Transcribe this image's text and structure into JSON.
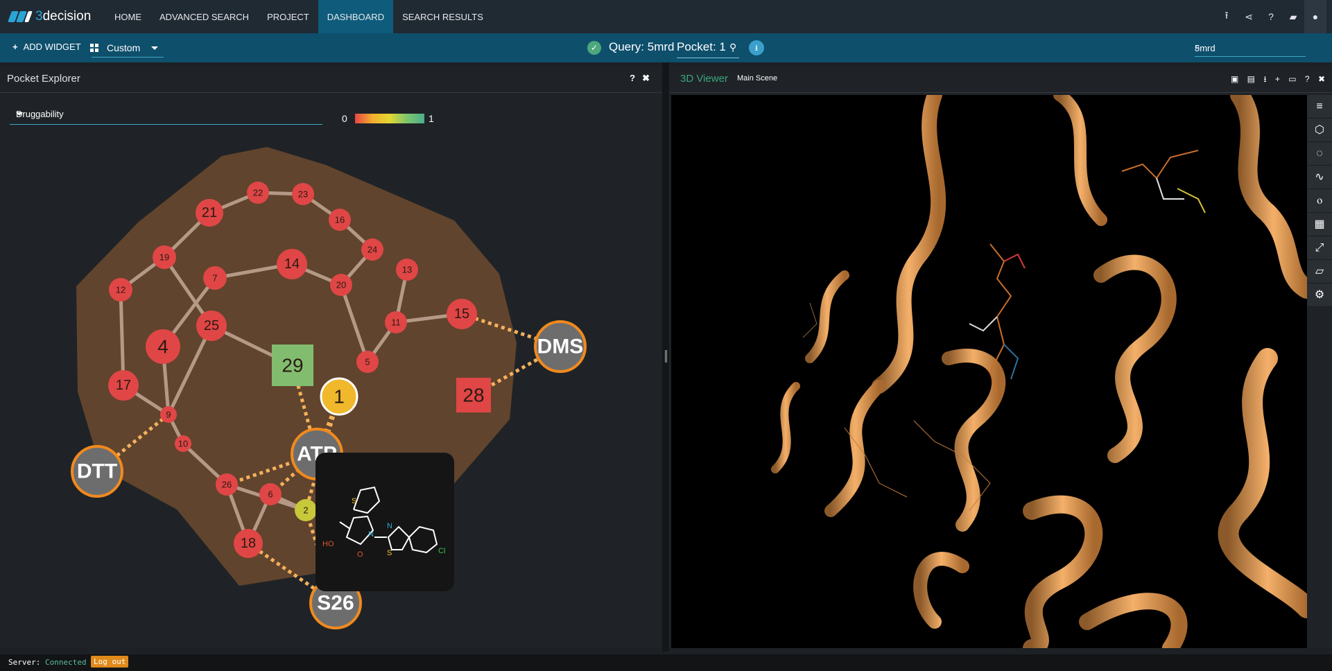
{
  "app": {
    "logo_text_a": "3",
    "logo_text_b": "decision"
  },
  "nav": {
    "items": [
      {
        "label": "HOME"
      },
      {
        "label": "ADVANCED SEARCH"
      },
      {
        "label": "PROJECT"
      },
      {
        "label": "DASHBOARD",
        "active": true
      },
      {
        "label": "SEARCH RESULTS"
      }
    ],
    "right_icons": [
      "upload-icon",
      "share-icon",
      "help-icon",
      "chat-icon",
      "user-icon"
    ]
  },
  "toolbar": {
    "add_widget_label": "ADD WIDGET",
    "layout_value": "Custom",
    "query_text": "Query: 5mrd",
    "pocket_value": "Pocket: 1",
    "search_value": "5mrd"
  },
  "pocket_explorer": {
    "title": "Pocket Explorer",
    "help": "?",
    "close": "✖",
    "property_select": "Druggability",
    "scale_min": "0",
    "scale_max": "1",
    "nodes": [
      {
        "label": "21",
        "kind": "circle",
        "color": "#e04646"
      },
      {
        "label": "22",
        "kind": "circle",
        "color": "#e04646"
      },
      {
        "label": "23",
        "kind": "circle",
        "color": "#e04646"
      },
      {
        "label": "16",
        "kind": "circle",
        "color": "#e04646"
      },
      {
        "label": "24",
        "kind": "circle",
        "color": "#e04646"
      },
      {
        "label": "19",
        "kind": "circle",
        "color": "#e04646"
      },
      {
        "label": "12",
        "kind": "circle",
        "color": "#e04646"
      },
      {
        "label": "7",
        "kind": "circle",
        "color": "#e04646"
      },
      {
        "label": "14",
        "kind": "circle",
        "color": "#e04646"
      },
      {
        "label": "20",
        "kind": "circle",
        "color": "#e04646"
      },
      {
        "label": "13",
        "kind": "circle",
        "color": "#e04646"
      },
      {
        "label": "11",
        "kind": "circle",
        "color": "#e04646"
      },
      {
        "label": "15",
        "kind": "circle",
        "color": "#e04646"
      },
      {
        "label": "25",
        "kind": "circle",
        "color": "#e04646"
      },
      {
        "label": "4",
        "kind": "circle",
        "color": "#e04646"
      },
      {
        "label": "17",
        "kind": "circle",
        "color": "#e04646"
      },
      {
        "label": "9",
        "kind": "circle",
        "color": "#e04646"
      },
      {
        "label": "10",
        "kind": "circle",
        "color": "#e04646"
      },
      {
        "label": "5",
        "kind": "circle",
        "color": "#e04646"
      },
      {
        "label": "1",
        "kind": "circle",
        "color": "#f0b82a"
      },
      {
        "label": "29",
        "kind": "square",
        "color": "#82bd6f"
      },
      {
        "label": "28",
        "kind": "square",
        "color": "#e04646"
      },
      {
        "label": "26",
        "kind": "circle",
        "color": "#e04646"
      },
      {
        "label": "6",
        "kind": "circle",
        "color": "#e04646"
      },
      {
        "label": "2",
        "kind": "circle",
        "color": "#c7c83a"
      },
      {
        "label": "18",
        "kind": "circle",
        "color": "#e04646"
      }
    ],
    "ligands": [
      {
        "label": "DMS"
      },
      {
        "label": "DTT"
      },
      {
        "label": "ATP"
      },
      {
        "label": "S26"
      }
    ],
    "tooltip": {
      "atoms": [
        "S",
        "N",
        "N",
        "S",
        "Cl",
        "HO",
        "O"
      ]
    }
  },
  "viewer": {
    "title": "3D Viewer",
    "scene": "Main Scene",
    "help": "?",
    "close": "✖",
    "header_icons": [
      "image-icon",
      "save-icon",
      "download-icon",
      "add-icon",
      "monitor-icon"
    ],
    "tools": [
      "menu-icon",
      "molecule-icon",
      "surface-icon",
      "ribbon-icon",
      "hbond-icon",
      "mesh-icon",
      "measure-icon",
      "ruler-icon",
      "gear-icon"
    ]
  },
  "status": {
    "server_label": "Server:",
    "server_state": "Connected",
    "logout_label": "Log out"
  }
}
